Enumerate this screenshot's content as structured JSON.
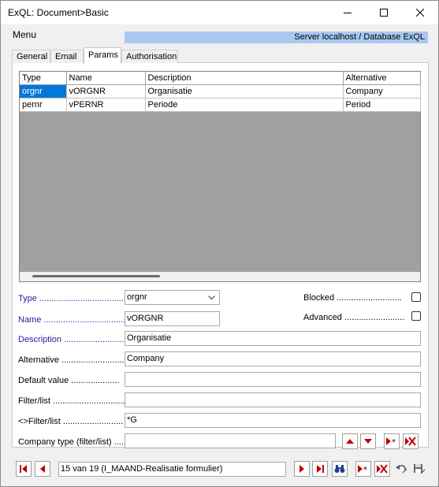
{
  "window": {
    "title": "ExQL: Document>Basic"
  },
  "menu": {
    "label": "Menu"
  },
  "server_banner": "Server localhost / Database ExQL",
  "tabs": [
    {
      "label": "General"
    },
    {
      "label": "Email"
    },
    {
      "label": "Params",
      "active": true
    },
    {
      "label": "Authorisation"
    }
  ],
  "grid": {
    "columns": [
      "Type",
      "Name",
      "Description",
      "Alternative"
    ],
    "rows": [
      [
        "orgnr",
        "vORGNR",
        "Organisatie",
        "Company"
      ],
      [
        "pernr",
        "vPERNR",
        "Periode",
        "Period"
      ]
    ],
    "selected_row": 0
  },
  "form": {
    "type_label": "Type ....................................",
    "type_value": "orgnr",
    "name_label": "Name ...................................",
    "name_value": "vORGNR",
    "description_label": "Description .........................",
    "description_value": "Organisatie",
    "alternative_label": "Alternative ..........................",
    "alternative_value": "Company",
    "default_label": "Default value ....................",
    "default_value": "",
    "filter_label": "Filter/list ...............................",
    "filter_value": "",
    "notfilter_label": "<>Filter/list .........................",
    "notfilter_value": "*G",
    "company_type_label": "Company type (filter/list) ....",
    "company_type_value": "",
    "blocked_label": "Blocked ...........................",
    "blocked_checked": false,
    "advanced_label": "Advanced .........................",
    "advanced_checked": false
  },
  "navigator": {
    "record_text": "15 van 19 (I_MAAND-Realisatie formulier)"
  },
  "colors": {
    "selection": "#0078d7",
    "banner": "#a8c8f0",
    "label_blue": "#1f1f9f",
    "nav_red": "#c00000"
  }
}
